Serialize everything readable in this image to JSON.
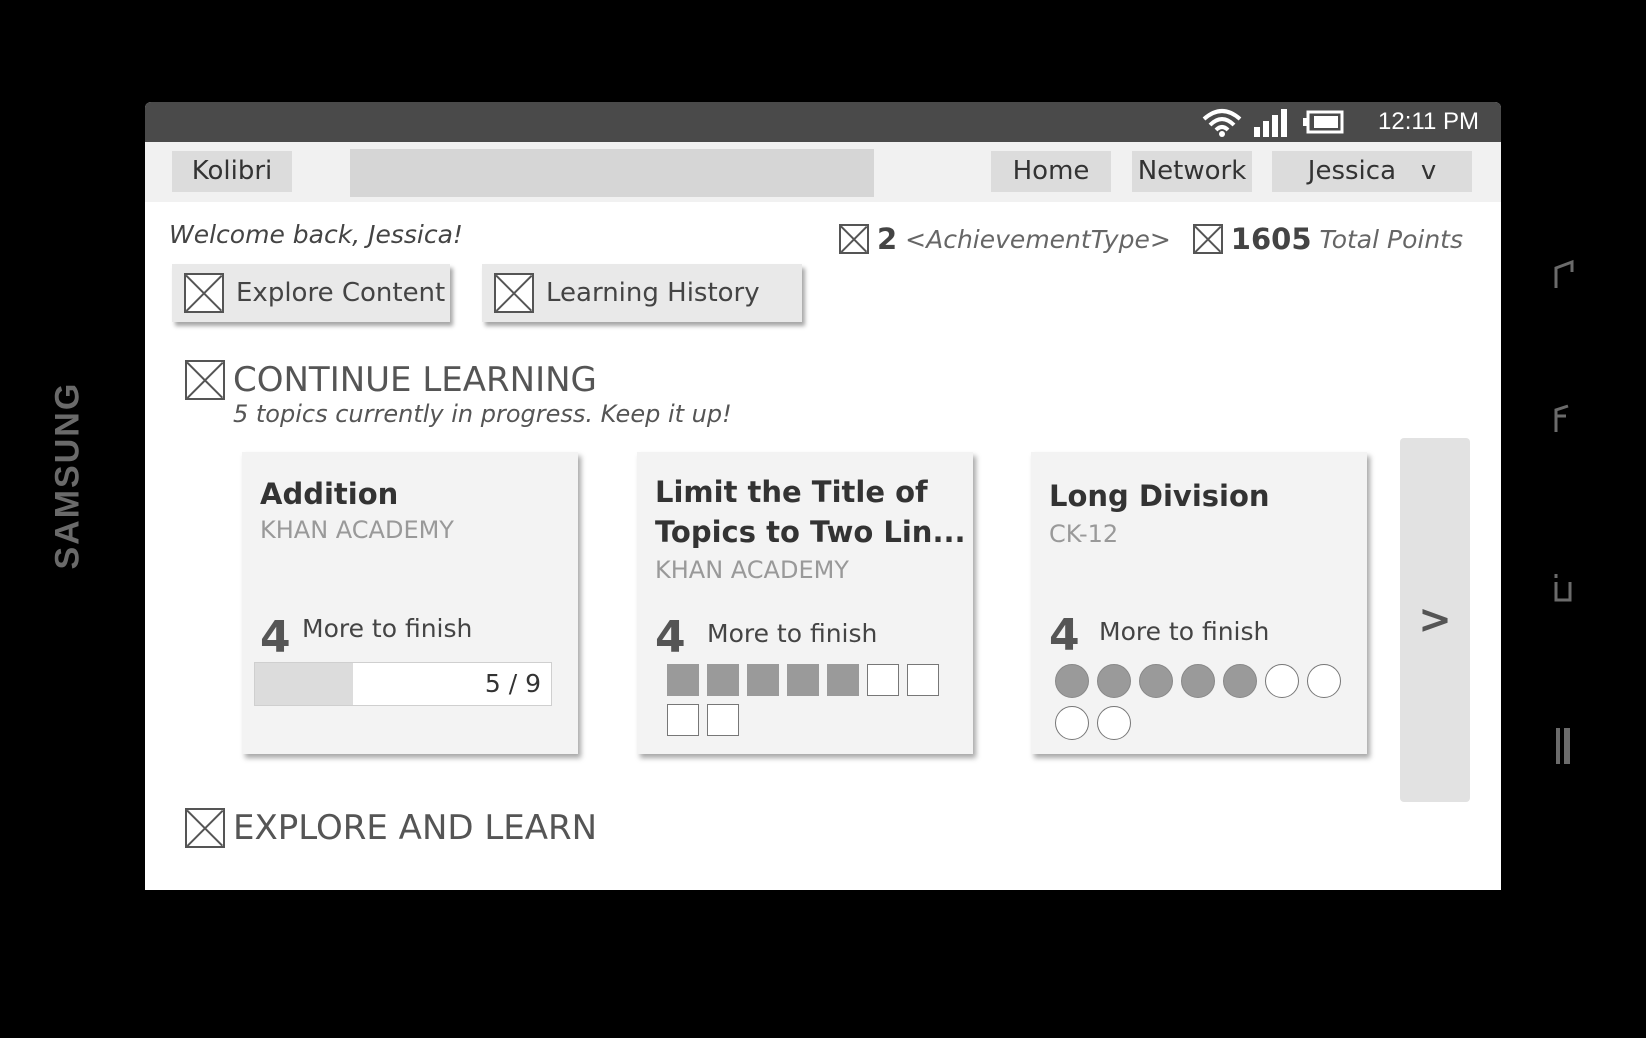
{
  "device": {
    "brand": "SAMSUNG"
  },
  "statusbar": {
    "time": "12:11 PM",
    "icons": [
      "wifi-icon",
      "signal-icon",
      "battery-icon"
    ]
  },
  "topbar": {
    "app_name": "Kolibri",
    "search_value": "",
    "nav": {
      "home": "Home",
      "network": "Network",
      "user": "Jessica",
      "user_caret": "v"
    }
  },
  "welcome": "Welcome back, Jessica!",
  "stats": {
    "achievement_count": "2",
    "achievement_label": "<AchievementType>",
    "points": "1605",
    "points_label": "Total Points"
  },
  "actions": {
    "explore": "Explore Content",
    "history": "Learning History"
  },
  "continue_learning": {
    "title": "CONTINUE LEARNING",
    "subtitle": "5 topics currently in progress. Keep it up!",
    "next_label": ">",
    "cards": [
      {
        "title": "Addition",
        "source": "KHAN ACADEMY",
        "remaining": "4",
        "remaining_label": "More to finish",
        "progress_text": "5 / 9",
        "progress_fraction": 0.33
      },
      {
        "title_line1": "Limit the Title of",
        "title_line2": "Topics to Two Lin...",
        "source": "KHAN ACADEMY",
        "remaining": "4",
        "remaining_label": "More to finish",
        "completed": 5,
        "total": 9
      },
      {
        "title": "Long Division",
        "source": "CK-12",
        "remaining": "4",
        "remaining_label": "More to finish",
        "completed": 5,
        "total": 9
      }
    ]
  },
  "explore_learn": {
    "title": "EXPLORE AND LEARN"
  },
  "colors": {
    "statusbar": "#4a4a4a",
    "topbar": "#f1f1f1",
    "card": "#f3f3f3",
    "progress_on": "#9a9a9a"
  }
}
